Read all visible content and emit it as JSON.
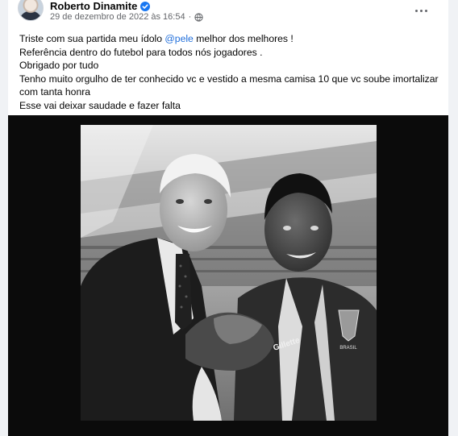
{
  "post": {
    "author": "Roberto Dinamite",
    "date": "29 de dezembro de 2022 às 16:54",
    "separator": "·",
    "lines": {
      "l1_before": "Triste com sua partida meu ídolo ",
      "l1_mention": "@pele",
      "l1_after": " melhor dos melhores !",
      "l2": "Referência dentro do futebol para todos nós jogadores .",
      "l3": "Obrigado por tudo",
      "l4": "Tenho muito orgulho de ter conhecido vc e vestido a mesma camisa 10 que vc soube imortalizar com tanta honra",
      "l5": "Esse vai deixar saudade e fazer falta"
    },
    "photo": {
      "shirt_text": "Gillette",
      "badge_text": "BRASIL"
    }
  },
  "icons": {
    "verified": "verified-badge-icon",
    "audience": "globe-icon",
    "more": "more-options-icon"
  },
  "colors": {
    "link": "#216fdb",
    "verified": "#1877f2",
    "meta": "#65676b",
    "background": "#f0f2f5"
  }
}
